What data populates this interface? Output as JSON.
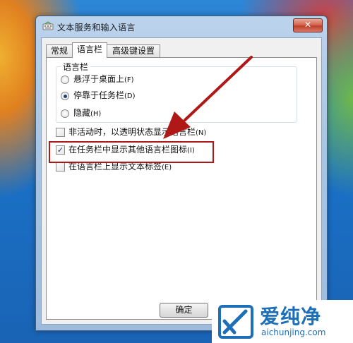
{
  "window": {
    "title": "文本服务和输入语言",
    "close_label": "✕"
  },
  "tabs": [
    {
      "label": "常规",
      "active": false
    },
    {
      "label": "语言栏",
      "active": true
    },
    {
      "label": "高级键设置",
      "active": false
    }
  ],
  "language_bar_group": {
    "title": "语言栏",
    "options": [
      {
        "label": "悬浮于桌面上",
        "hotkey": "(F)",
        "selected": false
      },
      {
        "label": "停靠于任务栏",
        "hotkey": "(D)",
        "selected": true
      },
      {
        "label": "隐藏",
        "hotkey": "(H)",
        "selected": false
      }
    ]
  },
  "checkboxes": [
    {
      "label": "非活动时，以透明状态显示语言栏",
      "hotkey": "(N)",
      "checked": false
    },
    {
      "label": "在任务栏中显示其他语言栏图标",
      "hotkey": "(I)",
      "checked": true
    },
    {
      "label": "在语言栏上显示文本标签",
      "hotkey": "(E)",
      "checked": false
    }
  ],
  "buttons": {
    "ok_label": "确定"
  },
  "watermark": {
    "brand_cn": "爱纯净",
    "url": "aichunjing.com"
  },
  "colors": {
    "highlight": "#b01818",
    "arrow": "#b01818",
    "brand": "#1d6fb8"
  }
}
